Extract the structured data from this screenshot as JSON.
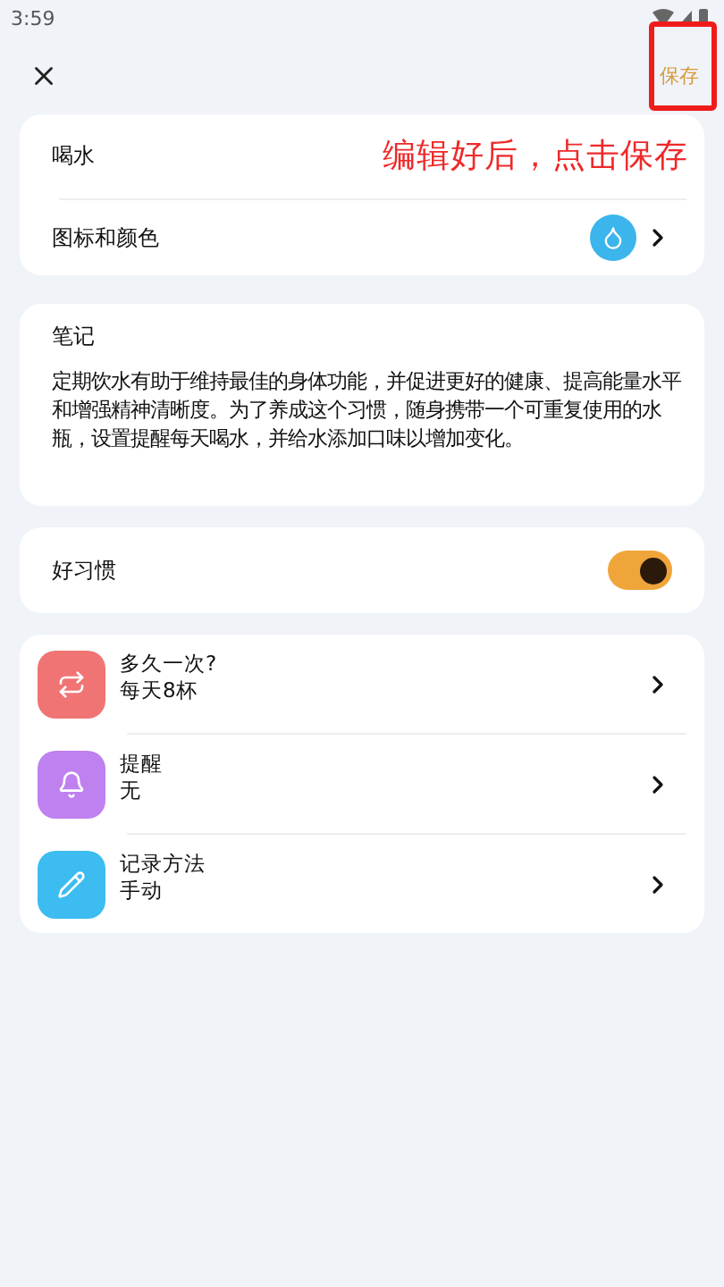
{
  "status_bar": {
    "time": "3:59"
  },
  "header": {
    "save": "保存"
  },
  "annotation": {
    "text": "编辑好后，点击保存"
  },
  "habit_card": {
    "name": "喝水",
    "icon_row": {
      "label": "图标和颜色",
      "color": "#3cb4ec"
    }
  },
  "notes": {
    "title": "笔记",
    "text": "定期饮水有助于维持最佳的身体功能，并促进更好的健康、提高能量水平和增强精神清晰度。为了养成这个习惯，随身携带一个可重复使用的水瓶，设置提醒每天喝水，并给水添加口味以增加变化。"
  },
  "good_habit": {
    "label": "好习惯",
    "on": true
  },
  "settings": [
    {
      "kind": "repeat",
      "color": "#f07474",
      "title": "多久一次?",
      "value": "每天8杯"
    },
    {
      "kind": "bell",
      "color": "#bf80f0",
      "title": "提醒",
      "value": "无"
    },
    {
      "kind": "pencil",
      "color": "#3cbcf0",
      "title": "记录方法",
      "value": "手动"
    }
  ]
}
